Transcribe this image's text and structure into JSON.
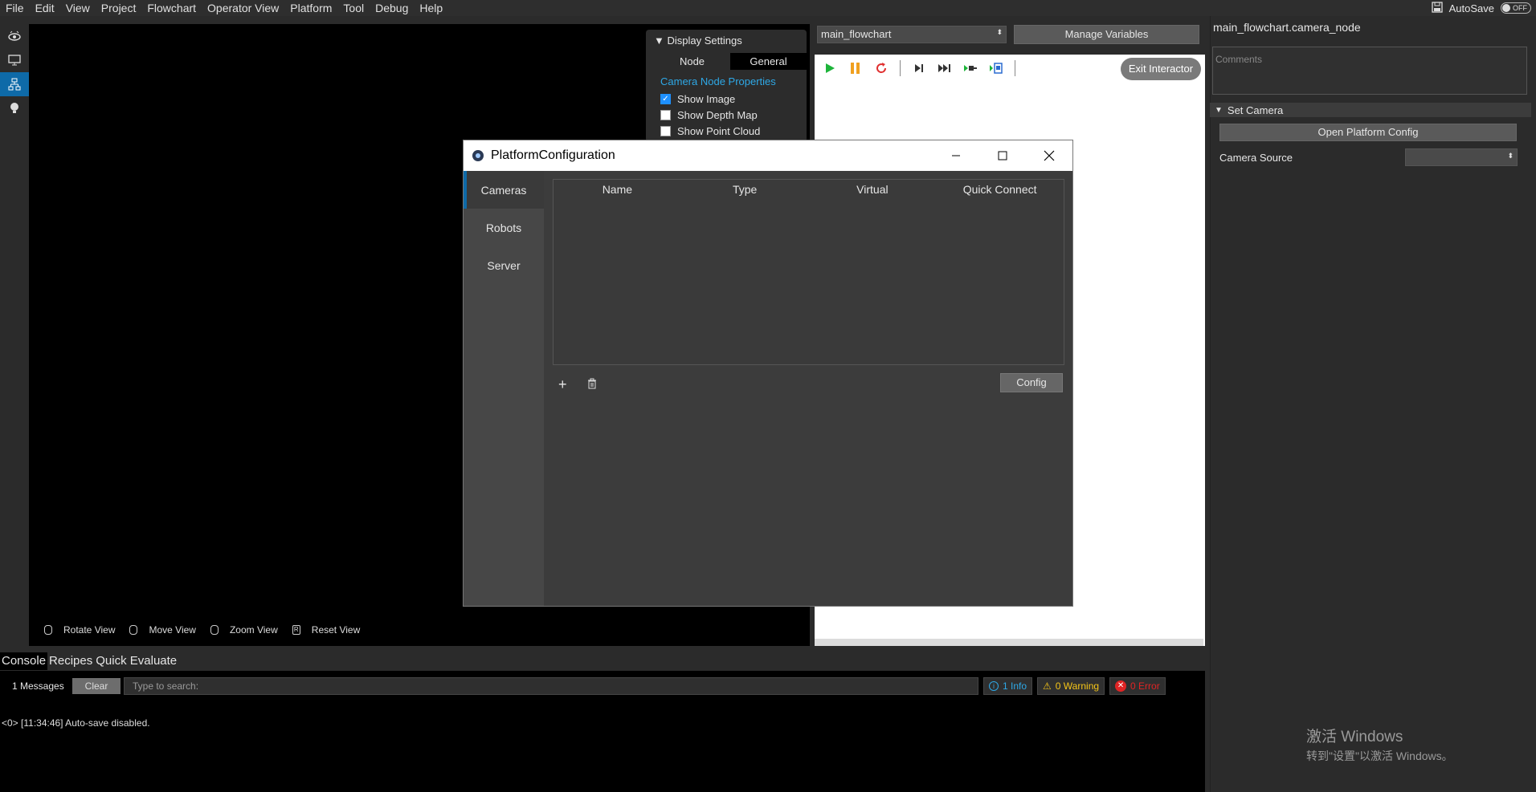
{
  "menubar": {
    "items": [
      "File",
      "Edit",
      "View",
      "Project",
      "Flowchart",
      "Operator View",
      "Platform",
      "Tool",
      "Debug",
      "Help"
    ],
    "autosave_label": "AutoSave",
    "autosave_state": "OFF"
  },
  "display_settings": {
    "title": "Display Settings",
    "tabs": [
      "Node",
      "General"
    ],
    "section": "Camera Node Properties",
    "options": [
      {
        "label": "Show Image",
        "checked": true
      },
      {
        "label": "Show Depth Map",
        "checked": false
      },
      {
        "label": "Show Point Cloud",
        "checked": false
      }
    ]
  },
  "view_hints": [
    "Rotate View",
    "Move View",
    "Zoom View",
    "Reset View"
  ],
  "flowchart": {
    "selected": "main_flowchart",
    "manage_label": "Manage Variables",
    "exit_label": "Exit Interactor"
  },
  "right_panel": {
    "node_title": "main_flowchart.camera_node",
    "comments_placeholder": "Comments",
    "set_camera": "Set Camera",
    "open_platform": "Open Platform Config",
    "camera_source_label": "Camera Source"
  },
  "dialog": {
    "title": "PlatformConfiguration",
    "tabs": [
      "Cameras",
      "Robots",
      "Server"
    ],
    "columns": [
      "Name",
      "Type",
      "Virtual",
      "Quick Connect"
    ],
    "add": "+",
    "config_label": "Config"
  },
  "console": {
    "tabs": [
      "Console",
      "Recipes",
      "Quick Evaluate"
    ],
    "messages": "1 Messages",
    "clear": "Clear",
    "search_placeholder": "Type to search:",
    "info": "1 Info",
    "warning": "0 Warning",
    "error": "0 Error",
    "log": "<0> [11:34:46] Auto-save disabled."
  },
  "watermark": {
    "line1": "激活 Windows",
    "line2": "转到\"设置\"以激活 Windows。"
  },
  "colors": {
    "accent": "#0e6aa8",
    "info": "#2ea8e6",
    "warning": "#f5c518",
    "error": "#e02424"
  }
}
